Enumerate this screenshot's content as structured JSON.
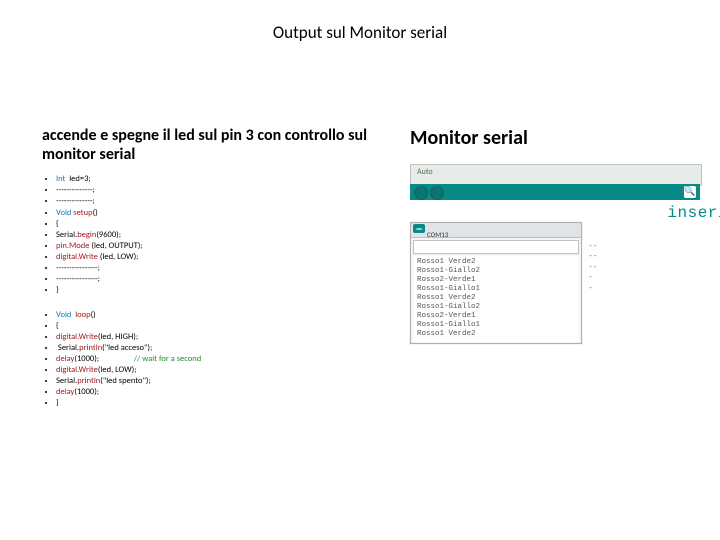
{
  "title": "Output sul Monitor serial",
  "left": {
    "heading": "accende e spegne il led sul pin 3 con controllo sul monitor serial",
    "block1": [
      {
        "html": "<span class='int'>Int</span>  led=3;"
      },
      {
        "html": "--------------;"
      },
      {
        "html": "--------------;"
      },
      {
        "html": "<span class='void'>Void</span> <span class='red'>setup</span>()"
      },
      {
        "html": "{"
      },
      {
        "html": "Serial.<span class='red'>begin</span>(9600);"
      },
      {
        "html": "<span class='red'>pin.Mode</span> (led, OUTPUT);"
      },
      {
        "html": "<span class='red'>digital.Write</span> (led, LOW);"
      },
      {
        "html": "----------------;"
      },
      {
        "html": "----------------;"
      },
      {
        "html": "}"
      }
    ],
    "block2": [
      {
        "html": "<span class='void'>Void</span>  <span class='red'>loop</span>()"
      },
      {
        "html": "{"
      },
      {
        "html": "<span class='red'>digital.Write</span>(led, HIGH);"
      },
      {
        "html": " Serial.<span class='red'>println</span>(\"led acceso\");"
      },
      {
        "html": "<span class='red'>delay</span>(1000);                  <span class='green'>// wait for a second</span>"
      },
      {
        "html": "<span class='red'>digital.Write</span>(led, LOW);"
      },
      {
        "html": "Serial.<span class='red'>println</span>(\"led spento\");"
      },
      {
        "html": "<span class='red'>delay</span>(1000);"
      },
      {
        "html": "}"
      }
    ]
  },
  "right": {
    "heading": "Monitor serial",
    "ide_label": "Auto",
    "badge": "∞",
    "com": "COM13",
    "mag": "🔍",
    "inserire": "inseri",
    "serial_lines": [
      "Rosso1 Verde2",
      "Rosso1-Giallo2",
      "Rosso2-Verde1",
      "Rosso1-Giallo1",
      "Rosso1 Verde2",
      "Rosso1-Giallo2",
      "Rosso2-Verde1",
      "Rosso1-Giallo1",
      "Rosso1 Verde2"
    ],
    "side_lines": [
      "--",
      "--",
      "--",
      "-",
      "-"
    ]
  }
}
